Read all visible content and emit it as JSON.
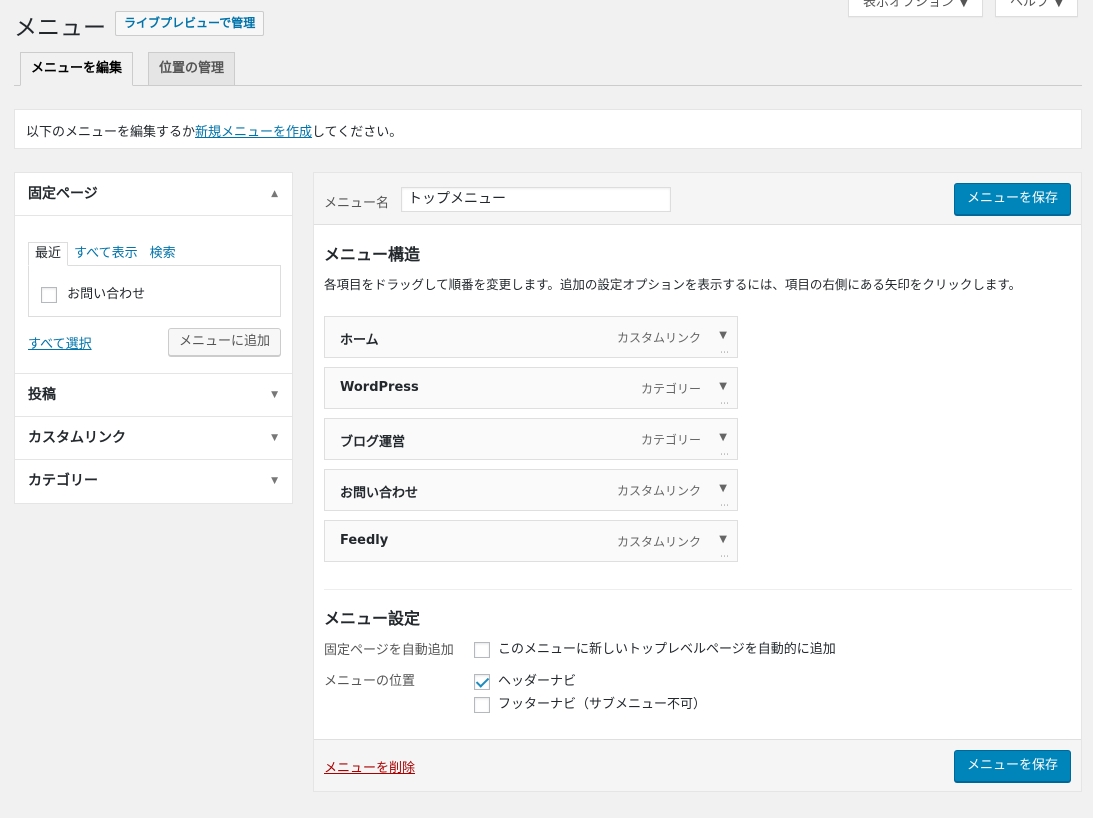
{
  "screen_options": {
    "display_options_label": "表示オプション",
    "help_label": "ヘルプ"
  },
  "header": {
    "title": "メニュー",
    "live_preview_label": "ライブプレビューで管理"
  },
  "tabs": [
    {
      "label": "メニューを編集"
    },
    {
      "label": "位置の管理"
    }
  ],
  "notice": {
    "prefix": "以下のメニューを編集するか",
    "link": "新規メニューを作成",
    "suffix": "してください。"
  },
  "sidebar": {
    "sections": [
      {
        "label": "固定ページ"
      },
      {
        "label": "投稿"
      },
      {
        "label": "カスタムリンク"
      },
      {
        "label": "カテゴリー"
      }
    ],
    "inner_tabs": [
      {
        "label": "最近"
      },
      {
        "label": "すべて表示"
      },
      {
        "label": "検索"
      }
    ],
    "page_items": [
      {
        "label": "お問い合わせ",
        "checked": false
      }
    ],
    "select_all_label": "すべて選択",
    "add_to_menu_label": "メニューに追加"
  },
  "main": {
    "menu_name_label": "メニュー名",
    "menu_name_value": "トップメニュー",
    "save_label": "メニューを保存",
    "structure_title": "メニュー構造",
    "structure_help": "各項目をドラッグして順番を変更します。追加の設定オプションを表示するには、項目の右側にある矢印をクリックします。",
    "items": [
      {
        "title": "ホーム",
        "type": "カスタムリンク"
      },
      {
        "title": "WordPress",
        "type": "カテゴリー"
      },
      {
        "title": "ブログ運営",
        "type": "カテゴリー"
      },
      {
        "title": "お問い合わせ",
        "type": "カスタムリンク"
      },
      {
        "title": "Feedly",
        "type": "カスタムリンク"
      }
    ],
    "settings_title": "メニュー設定",
    "auto_add_label": "固定ページを自動追加",
    "auto_add_option": "このメニューに新しいトップレベルページを自動的に追加",
    "location_label": "メニューの位置",
    "locations": [
      {
        "label": "ヘッダーナビ",
        "checked": true
      },
      {
        "label": "フッターナビ（サブメニュー不可）",
        "checked": false
      }
    ],
    "delete_label": "メニューを削除"
  },
  "colors": {
    "primary": "#0085ba",
    "link": "#0073aa",
    "danger": "#a00",
    "background": "#f1f1f1"
  }
}
